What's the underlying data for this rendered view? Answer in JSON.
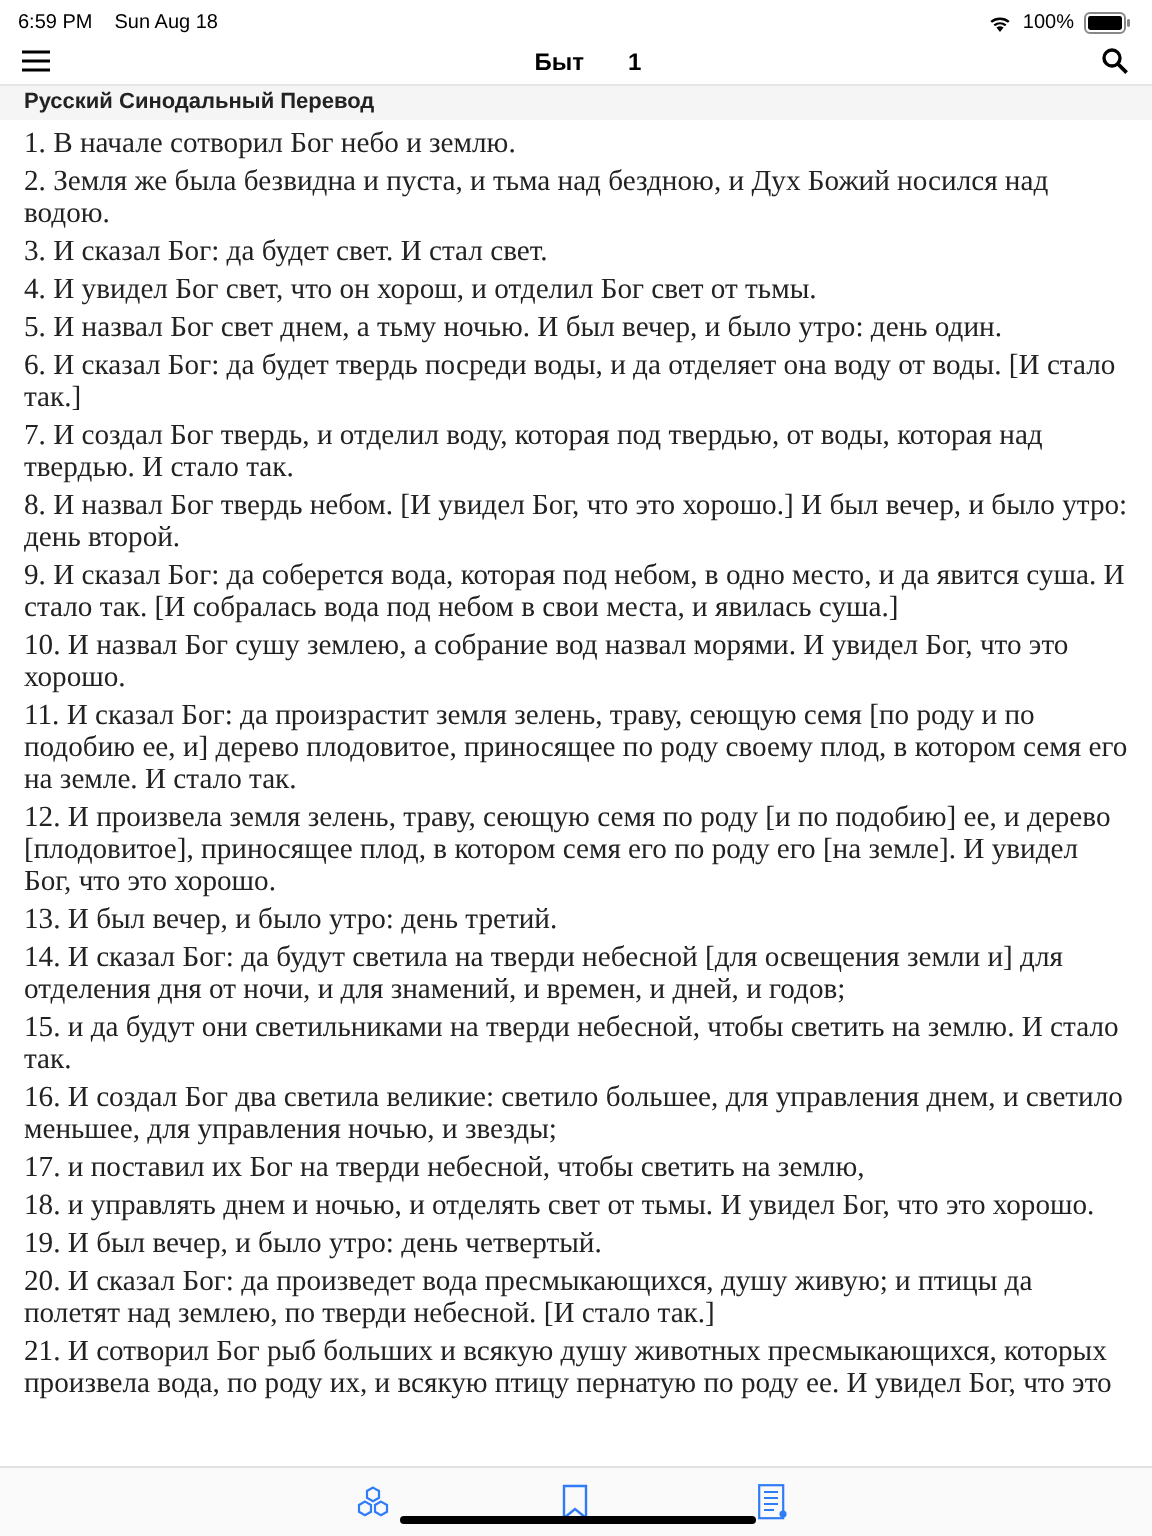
{
  "status_bar": {
    "time": "6:59 PM",
    "date": "Sun Aug 18",
    "battery": "100%"
  },
  "nav_bar": {
    "book": "Быт",
    "chapter": "1"
  },
  "translation": "Русский Синодальный Перевод",
  "verses": [
    "1. В начале сотворил Бог небо и землю.",
    "2. Земля же была безвидна и пуста, и тьма над бездною, и Дух Божий носился над водою.",
    "3. И сказал Бог: да будет свет. И стал свет.",
    "4. И увидел Бог свет, что он хорош, и отделил Бог свет от тьмы.",
    "5. И назвал Бог свет днем, а тьму ночью. И был вечер, и было утро: день один.",
    "6. И сказал Бог: да будет твердь посреди воды, и да отделяет она воду от воды. [И стало так.]",
    "7. И создал Бог твердь, и отделил воду, которая под твердью, от воды, которая над твердью. И стало так.",
    "8. И назвал Бог твердь небом. [И увидел Бог, что это хорошо.] И был вечер, и было утро: день второй.",
    "9. И сказал Бог: да соберется вода, которая под небом, в одно место, и да явится суша. И стало так. [И собралась вода под небом в свои места, и явилась суша.]",
    "10. И назвал Бог сушу землею, а собрание вод назвал морями. И увидел Бог, что это хорошо.",
    "11. И сказал Бог: да произрастит земля зелень, траву, сеющую семя [по роду и по подобию ее, и] дерево плодовитое, приносящее по роду своему плод, в котором семя его на земле. И стало так.",
    "12. И произвела земля зелень, траву, сеющую семя по роду [и по подобию] ее, и дерево [плодовитое], приносящее плод, в котором семя его по роду его [на земле]. И увидел Бог, что это хорошо.",
    "13. И был вечер, и было утро: день третий.",
    "14. И сказал Бог: да будут светила на тверди небесной [для освещения земли и] для отделения дня от ночи, и для знамений, и времен, и дней, и годов;",
    "15. и да будут они светильниками на тверди небесной, чтобы светить на землю. И стало так.",
    "16. И создал Бог два светила великие: светило большее, для управления днем, и светило меньшее, для управления ночью, и звезды;",
    "17. и поставил их Бог на тверди небесной, чтобы светить на землю,",
    "18. и управлять днем и ночью, и отделять свет от тьмы. И увидел Бог, что это хорошо.",
    "19. И был вечер, и было утро: день четвертый.",
    "20. И сказал Бог: да произведет вода пресмыкающихся, душу живую; и птицы да полетят над землею, по тверди небесной. [И стало так.]",
    "21. И сотворил Бог рыб больших и всякую душу животных пресмыкающихся, которых произвела вода, по роду их, и всякую птицу пернатую по роду ее. И увидел Бог, что это"
  ]
}
